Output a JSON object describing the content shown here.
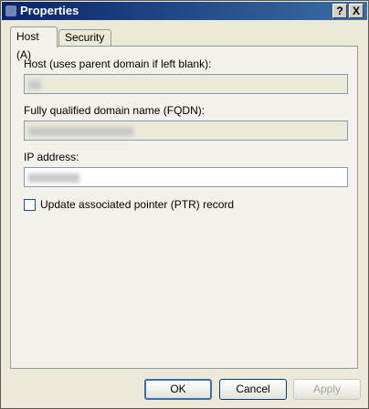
{
  "window": {
    "title": "Properties",
    "help_button": "?",
    "close_button": "X"
  },
  "tabs": [
    {
      "label": "Host (A)",
      "active": true
    },
    {
      "label": "Security",
      "active": false
    }
  ],
  "form": {
    "host_label": "Host (uses parent domain if left blank):",
    "fqdn_label": "Fully qualified domain name (FQDN):",
    "ip_label": "IP address:",
    "ptr_checkbox_label": "Update associated pointer (PTR) record",
    "ptr_checked": false
  },
  "buttons": {
    "ok": "OK",
    "cancel": "Cancel",
    "apply": "Apply"
  },
  "colors": {
    "title_bar_start": "#0a246a",
    "title_bar_end": "#3a6ea5",
    "dialog_background": "#ece9d8",
    "panel_background": "#f3f1e9"
  }
}
